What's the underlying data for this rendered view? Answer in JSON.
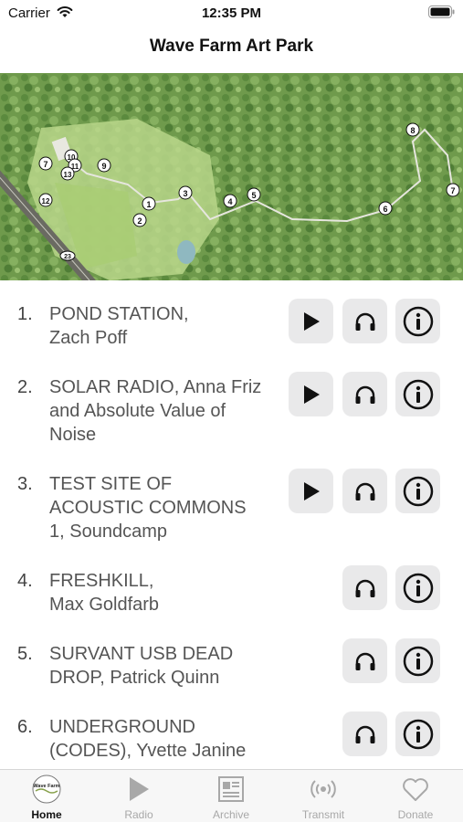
{
  "status_bar": {
    "carrier": "Carrier",
    "time": "12:35 PM"
  },
  "nav": {
    "title": "Wave Farm Art Park"
  },
  "map": {
    "markers": [
      "1",
      "2",
      "3",
      "4",
      "5",
      "6",
      "7",
      "7",
      "8",
      "9",
      "10",
      "11",
      "12",
      "13",
      "23"
    ]
  },
  "list": {
    "items": [
      {
        "number": "1.",
        "title": "POND STATION,",
        "artist": "Zach Poff",
        "text_lines": [
          "POND STATION,",
          "Zach Poff"
        ],
        "has_play": true
      },
      {
        "number": "2.",
        "title": "SOLAR RADIO,",
        "artist": "Anna Friz and Absolute Value of Noise",
        "text_lines": [
          "SOLAR RADIO, Anna Friz",
          "and Absolute Value of",
          "Noise"
        ],
        "has_play": true
      },
      {
        "number": "3.",
        "title": "TEST SITE OF ACOUSTIC COMMONS 1,",
        "artist": "Soundcamp",
        "text_lines": [
          "TEST SITE OF",
          "ACOUSTIC COMMONS",
          "1, Soundcamp"
        ],
        "has_play": true
      },
      {
        "number": "4.",
        "title": "FRESHKILL,",
        "artist": "Max Goldfarb",
        "text_lines": [
          "FRESHKILL,",
          "Max Goldfarb"
        ],
        "has_play": false
      },
      {
        "number": "5.",
        "title": "SURVANT USB DEAD DROP,",
        "artist": "Patrick Quinn",
        "text_lines": [
          "SURVANT USB DEAD",
          "DROP, Patrick Quinn"
        ],
        "has_play": false
      },
      {
        "number": "6.",
        "title": "UNDERGROUND (CODES),",
        "artist": "Yvette Janine",
        "text_lines": [
          "UNDERGROUND",
          "(CODES), Yvette Janine"
        ],
        "has_play": false
      }
    ]
  },
  "tab_bar": {
    "active": "Home",
    "tabs": [
      {
        "label": "Home",
        "icon": "wave-farm-logo-icon",
        "logo_text": "Wave Farm"
      },
      {
        "label": "Radio",
        "icon": "play-icon"
      },
      {
        "label": "Archive",
        "icon": "newspaper-icon"
      },
      {
        "label": "Transmit",
        "icon": "broadcast-icon"
      },
      {
        "label": "Donate",
        "icon": "heart-icon"
      }
    ]
  },
  "colors": {
    "accent": "#111111",
    "button_bg": "#e9e9ea",
    "tab_inactive": "#a8a8a8",
    "map_green": "#7fa85a"
  }
}
